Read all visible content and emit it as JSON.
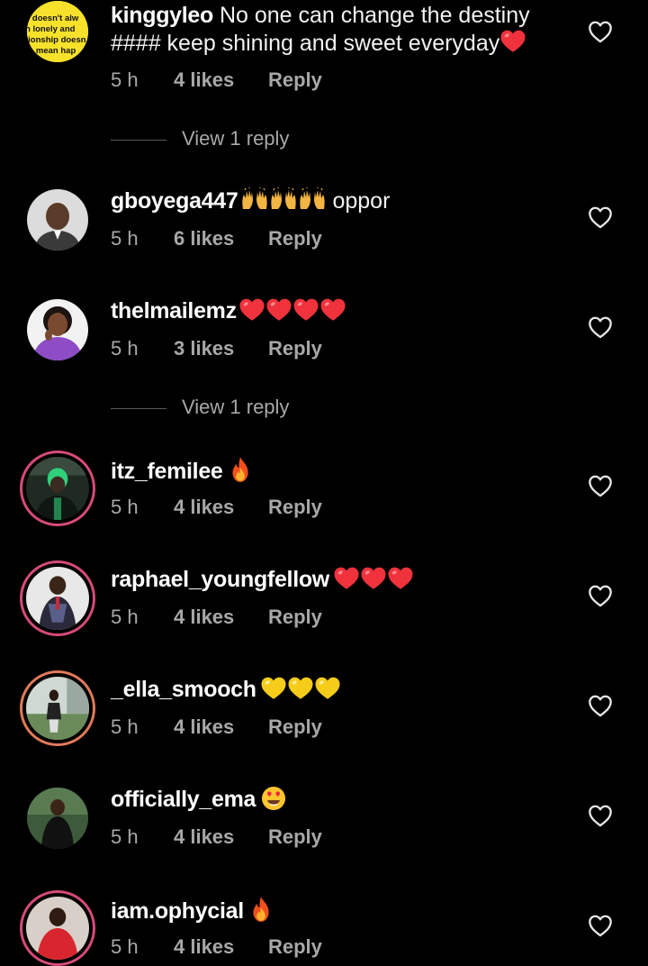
{
  "comments": [
    {
      "username": "kinggyleo",
      "text": "No one can change the destiny #### keep shining and sweet everyday",
      "avatar_text": [
        "e doesn't alw",
        "n lonely and",
        "tionship doesn",
        "s mean hap"
      ],
      "time": "5 h",
      "likes": "4 likes",
      "reply": "Reply",
      "view_replies": "View 1 reply"
    },
    {
      "username": "gboyega447",
      "text": "oppor",
      "time": "5 h",
      "likes": "6 likes",
      "reply": "Reply"
    },
    {
      "username": "thelmailemz",
      "text": "",
      "time": "5 h",
      "likes": "3 likes",
      "reply": "Reply",
      "view_replies": "View 1 reply"
    },
    {
      "username": "itz_femilee",
      "text": "",
      "time": "5 h",
      "likes": "4 likes",
      "reply": "Reply"
    },
    {
      "username": "raphael_youngfellow",
      "text": "",
      "time": "5 h",
      "likes": "4 likes",
      "reply": "Reply"
    },
    {
      "username": "_ella_smooch",
      "text": "",
      "time": "5 h",
      "likes": "4 likes",
      "reply": "Reply"
    },
    {
      "username": "officially_ema",
      "text": "",
      "time": "5 h",
      "likes": "4 likes",
      "reply": "Reply"
    },
    {
      "username": "iam.ophycial",
      "text": "",
      "time": "5 h",
      "likes": "4 likes",
      "reply": "Reply"
    }
  ],
  "icons": {
    "like": "heart-outline-icon",
    "red_heart": "red-heart-emoji",
    "yellow_heart": "yellow-heart-emoji",
    "fire": "fire-emoji",
    "heart_eyes": "heart-eyes-emoji",
    "raising_hands": "raising-hands-emoji"
  },
  "colors": {
    "background": "#000000",
    "meta": "#a8a8a8",
    "story_ring": "#d64a7a",
    "red_heart": "#f0323c",
    "yellow_heart": "#f5cc1a",
    "avatar_yellow": "#f7e12a"
  }
}
